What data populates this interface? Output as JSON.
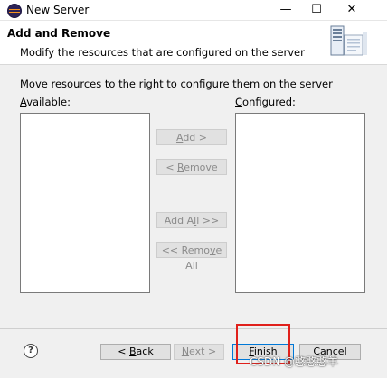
{
  "window": {
    "title": "New Server",
    "minimize": "—",
    "maximize": "☐",
    "close": "✕"
  },
  "header": {
    "title": "Add and Remove",
    "description": "Modify the resources that are configured on the server",
    "icon": "server-wizard-icon"
  },
  "main": {
    "instruction": "Move resources to the right to configure them on the server",
    "available": {
      "label_mnemonic": "A",
      "label_rest": "vailable:",
      "items": []
    },
    "configured": {
      "label_mnemonic": "C",
      "label_rest": "onfigured:",
      "items": []
    },
    "buttons": {
      "add": {
        "pre": "",
        "mnemonic": "A",
        "post": "dd >"
      },
      "remove": {
        "pre": "< ",
        "mnemonic": "R",
        "post": "emove"
      },
      "add_all": {
        "pre": "Add A",
        "mnemonic": "l",
        "post": "l >>"
      },
      "remove_all": {
        "pre": "<< Remo",
        "mnemonic": "v",
        "post": "e All"
      }
    }
  },
  "footer": {
    "help": "?",
    "back": {
      "pre": "< ",
      "mnemonic": "B",
      "post": "ack"
    },
    "next": {
      "mnemonic": "N",
      "post": "ext >"
    },
    "finish": {
      "mnemonic": "F",
      "post": "inish"
    },
    "cancel": "Cancel"
  },
  "watermark": "CSDN @憨憨憨羊",
  "colors": {
    "highlight_box": "#e0201b",
    "default_button_border": "#0078d7"
  }
}
